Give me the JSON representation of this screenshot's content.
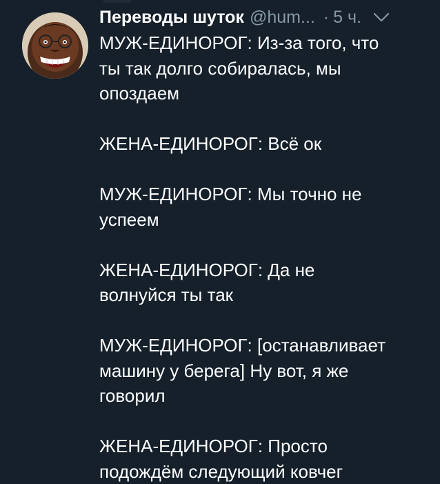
{
  "tweet": {
    "display_name": "Переводы шуток",
    "handle": "@hum...",
    "separator": "·",
    "time": "5 ч.",
    "icons": {
      "avatar": "avatar",
      "caret": "chevron-down-icon"
    },
    "text": "МУЖ-ЕДИНОРОГ: Из-за того, что\nты так долго собиралась, мы\nопоздаем\n\nЖЕНА-ЕДИНОРОГ: Всё ок\n\nМУЖ-ЕДИНОРОГ: Мы точно не\nуспеем\n\nЖЕНА-ЕДИНОРОГ: Да не\nволнуйся ты так\n\nМУЖ-ЕДИНОРОГ: [останавливает\nмашину у берега] Ну вот, я же\nговорил\n\nЖЕНА-ЕДИНОРОГ: Просто\nподождём следующий ковчег"
  },
  "colors": {
    "background": "#15202b",
    "text_primary": "#ffffff",
    "text_secondary": "#8899a6"
  }
}
